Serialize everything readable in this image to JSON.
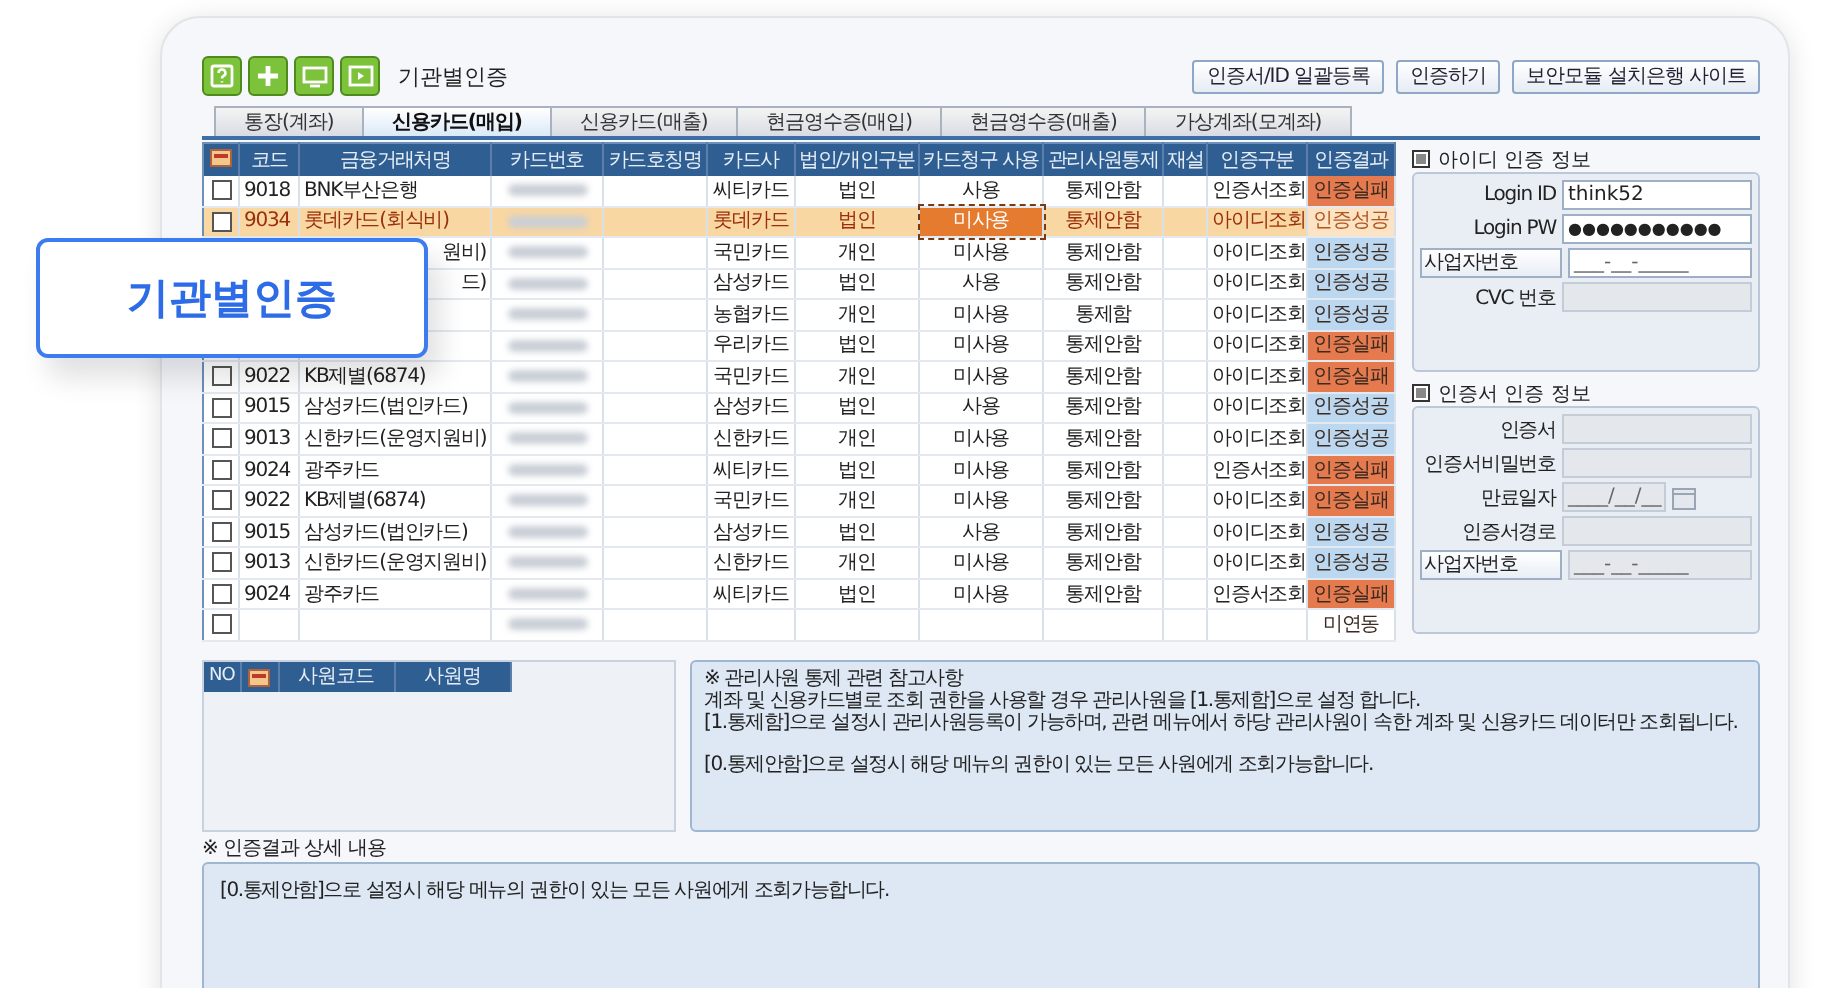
{
  "callout": {
    "text": "기관별인증"
  },
  "toolbar": {
    "title": "기관별인증",
    "buttons": [
      "인증서/ID 일괄등록",
      "인증하기",
      "보안모듈 설치은행 사이트"
    ]
  },
  "tabs": [
    {
      "label": "통장(계좌)",
      "selected": false
    },
    {
      "label": "신용카드(매입)",
      "selected": true
    },
    {
      "label": "신용카드(매출)",
      "selected": false
    },
    {
      "label": "현금영수증(매입)",
      "selected": false
    },
    {
      "label": "현금영수증(매출)",
      "selected": false
    },
    {
      "label": "가상계좌(모계좌)",
      "selected": false
    }
  ],
  "table": {
    "columns": [
      "코드",
      "금융거래처명",
      "카드번호",
      "카드호칭명",
      "카드사",
      "법인/개인구분",
      "카드청구 사용",
      "관리사원통제",
      "재설",
      "인증구분",
      "인증결과"
    ],
    "rows": [
      {
        "selected": false,
        "checked": false,
        "code": "9018",
        "name": "BNK부산은행",
        "issuer": "씨티카드",
        "type": "법인",
        "billing": "사용",
        "billing_focused": false,
        "control": "통제안함",
        "auth": "인증서조회",
        "result": "인증실패",
        "color": "#e67a4f"
      },
      {
        "selected": true,
        "checked": false,
        "code": "9034",
        "name": "롯데카드(회식비)",
        "issuer": "롯데카드",
        "type": "법인",
        "billing": "미사용",
        "billing_focused": true,
        "control": "통제안함",
        "auth": "아이디조회",
        "result": "인증성공",
        "color": "#fbe3c4"
      },
      {
        "selected": false,
        "name": "원비)",
        "issuer": "국민카드",
        "type": "개인",
        "billing": "미사용",
        "billing_focused": false,
        "control": "통제안함",
        "auth": "아이디조회",
        "result": "인증성공",
        "color": "#bcd8f0"
      },
      {
        "selected": false,
        "name": "드)",
        "issuer": "삼성카드",
        "type": "법인",
        "billing": "사용",
        "billing_focused": false,
        "control": "통제안함",
        "auth": "아이디조회",
        "result": "인증성공",
        "color": "#bcd8f0"
      },
      {
        "selected": false,
        "issuer": "농협카드",
        "type": "개인",
        "billing": "미사용",
        "billing_focused": false,
        "control": "통제함",
        "auth": "아이디조회",
        "result": "인증성공",
        "color": "#bcd8f0"
      },
      {
        "selected": false,
        "issuer": "우리카드",
        "type": "법인",
        "billing": "미사용",
        "billing_focused": false,
        "control": "통제안함",
        "auth": "아이디조회",
        "result": "인증실패",
        "color": "#e67a4f"
      },
      {
        "selected": false,
        "checked": false,
        "code": "9022",
        "name": "KB제별(6874)",
        "issuer": "국민카드",
        "type": "개인",
        "billing": "미사용",
        "billing_focused": false,
        "control": "통제안함",
        "auth": "아이디조회",
        "result": "인증실패",
        "color": "#e67a4f"
      },
      {
        "selected": false,
        "checked": false,
        "code": "9015",
        "name": "삼성카드(법인카드)",
        "issuer": "삼성카드",
        "type": "법인",
        "billing": "사용",
        "billing_focused": false,
        "control": "통제안함",
        "auth": "아이디조회",
        "result": "인증성공",
        "color": "#bcd8f0"
      },
      {
        "selected": false,
        "checked": false,
        "code": "9013",
        "name": "신한카드(운영지원비)",
        "issuer": "신한카드",
        "type": "개인",
        "billing": "미사용",
        "billing_focused": false,
        "control": "통제안함",
        "auth": "아이디조회",
        "result": "인증성공",
        "color": "#bcd8f0"
      },
      {
        "selected": false,
        "checked": false,
        "code": "9024",
        "name": "광주카드",
        "issuer": "씨티카드",
        "type": "법인",
        "billing": "미사용",
        "billing_focused": false,
        "control": "통제안함",
        "auth": "인증서조회",
        "result": "인증실패",
        "color": "#e67a4f"
      },
      {
        "selected": false,
        "checked": false,
        "code": "9022",
        "name": "KB제별(6874)",
        "issuer": "국민카드",
        "type": "개인",
        "billing": "미사용",
        "billing_focused": false,
        "control": "통제안함",
        "auth": "아이디조회",
        "result": "인증실패",
        "color": "#e67a4f"
      },
      {
        "selected": false,
        "checked": false,
        "code": "9015",
        "name": "삼성카드(법인카드)",
        "issuer": "삼성카드",
        "type": "법인",
        "billing": "사용",
        "billing_focused": false,
        "control": "통제안함",
        "auth": "아이디조회",
        "result": "인증성공",
        "color": "#bcd8f0"
      },
      {
        "selected": false,
        "checked": false,
        "code": "9013",
        "name": "신한카드(운영지원비)",
        "issuer": "신한카드",
        "type": "개인",
        "billing": "미사용",
        "billing_focused": false,
        "control": "통제안함",
        "auth": "아이디조회",
        "result": "인증성공",
        "color": "#bcd8f0"
      },
      {
        "selected": false,
        "checked": false,
        "code": "9024",
        "name": "광주카드",
        "issuer": "씨티카드",
        "type": "법인",
        "billing": "미사용",
        "billing_focused": false,
        "control": "통제안함",
        "auth": "인증서조회",
        "result": "인증실패",
        "color": "#e67a4f"
      },
      {
        "selected": false,
        "checked": false,
        "billing_focused": false,
        "result": "미연동",
        "color": "#ffffff"
      }
    ]
  },
  "id_auth": {
    "title": "아이디 인증 정보",
    "login_id_label": "Login ID",
    "login_id": "think52",
    "login_pw_label": "Login PW",
    "login_pw": "●●●●●●●●●●●",
    "biz_select": "사업자번호",
    "biz_mask": "___-__-_____",
    "cvc_label": "CVC 번호"
  },
  "cert_auth": {
    "title": "인증서 인증 정보",
    "cert_label": "인증서",
    "pw_label": "인증서비밀번호",
    "expiry_label": "만료일자",
    "expiry_mask": "____/__/__",
    "path_label": "인증서경로",
    "biz_select": "사업자번호",
    "biz_mask": "___-__-_____"
  },
  "employee_table": {
    "columns": [
      "NO",
      "사원코드",
      "사원명"
    ]
  },
  "notice": {
    "lines": [
      "※ 관리사원 통제 관련 참고사항",
      "계좌 및 신용카드별로 조회 권한을 사용할 경우 관리사원을 [1.통제함]으로 설정 합니다.",
      "[1.통제함]으로 설정시 관리사원등록이 가능하며, 관련 메뉴에서 하당 관리사원이 속한 계좌 및 신용카드 데이터만 조회됩니다."
    ],
    "footer": "[0.통제안함]으로 설정시 해당 메뉴의 권한이 있는 모든 사원에게 조회가능합니다."
  },
  "detail": {
    "title": "※ 인증결과 상세 내용",
    "text": "[0.통제안함]으로 설정시 해당 메뉴의 권한이 있는 모든 사원에게 조회가능합니다."
  }
}
